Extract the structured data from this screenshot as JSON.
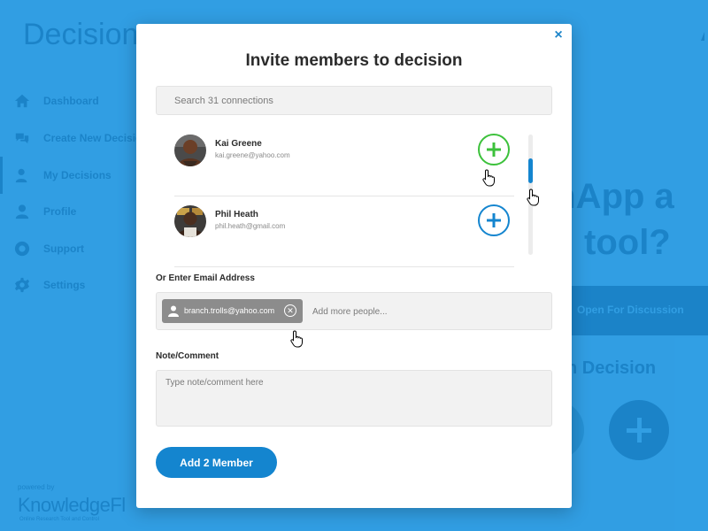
{
  "background": {
    "app_logo": "Decision",
    "nav": [
      {
        "label": "Dashboard",
        "icon": "home-icon"
      },
      {
        "label": "Create New Decision",
        "icon": "chat-bubbles-icon"
      },
      {
        "label": "My Decisions",
        "icon": "user-decisions-icon"
      },
      {
        "label": "Profile",
        "icon": "user-icon"
      },
      {
        "label": "Support",
        "icon": "lifebuoy-icon"
      },
      {
        "label": "Settings",
        "icon": "gear-icon"
      }
    ],
    "powered_by": "powered by",
    "brand": "KnowledgeFl",
    "brand_tagline": "Online Research Tool and Control",
    "hero_line1": "chApp a",
    "hero_line2": "tool?",
    "open_band_label": "Open For Discussion",
    "decision_heading": "n Decision"
  },
  "modal": {
    "close_label": "×",
    "title": "Invite members to decision",
    "search_placeholder": "Search 31 connections",
    "members": [
      {
        "name": "Kai Greene",
        "email": "kai.greene@yahoo.com",
        "added": true,
        "button_color": "#3cc13b"
      },
      {
        "name": "Phil Heath",
        "email": "phil.heath@gmail.com",
        "added": false,
        "button_color": "#1485cf"
      }
    ],
    "email_label": "Or Enter Email Address",
    "email_chip": "branch.trolls@yahoo.com",
    "email_chip_remove": "⊗",
    "email_placeholder": "Add more people...",
    "note_label": "Note/Comment",
    "note_placeholder": "Type note/comment here",
    "submit_label": "Add 2 Member"
  },
  "colors": {
    "accent": "#1485cf",
    "added_green": "#3cc13b",
    "background_blue": "#3aa7ea"
  }
}
